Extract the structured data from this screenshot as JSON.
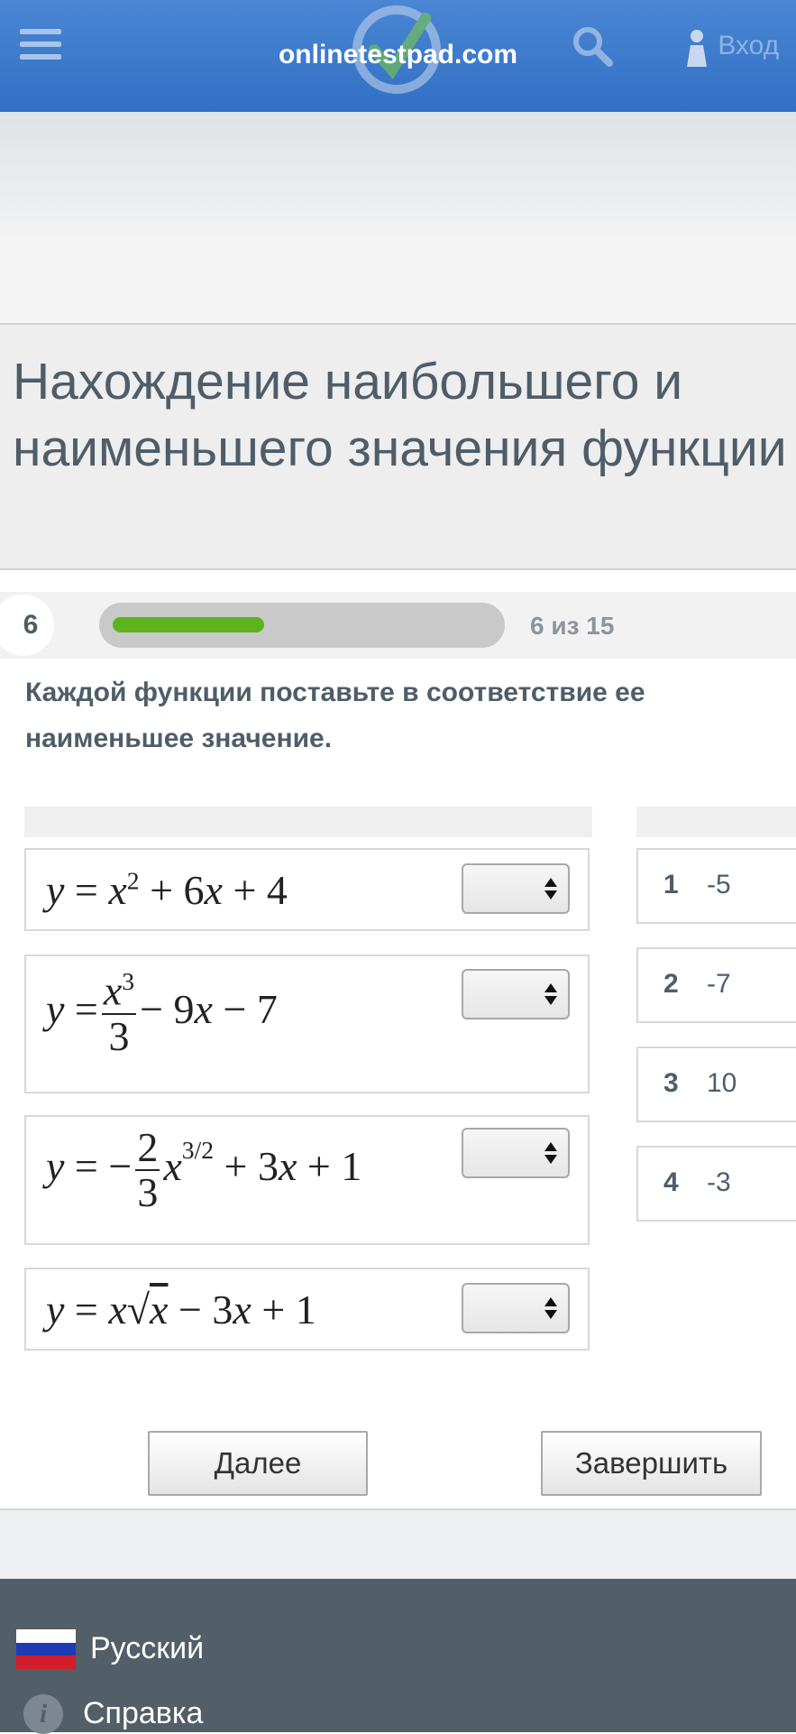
{
  "header": {
    "site_name": "onlinetestpad.com",
    "login_label": "Вход",
    "icons": [
      "hamburger-menu-icon",
      "logo-icon",
      "search-icon",
      "user-icon"
    ]
  },
  "test": {
    "title": "Нахождение наибольшего и наименьшего значения функции"
  },
  "progress": {
    "current_number": "6",
    "text": "6 из 15",
    "fraction": 0.4,
    "bar_color": "#5cb31d"
  },
  "question": {
    "text": "Каждой функции поставьте в соответствие ее наименьшее значение."
  },
  "functions": [
    {
      "formula": "y = x² + 6x + 4",
      "selected": ""
    },
    {
      "formula": "y = x³/3 − 9x − 7",
      "selected": ""
    },
    {
      "formula": "y = −(2/3)x^(3/2) + 3x + 1",
      "selected": ""
    },
    {
      "formula": "y = x√x − 3x + 1",
      "selected": ""
    }
  ],
  "answers": [
    {
      "num": "1",
      "value": "-5"
    },
    {
      "num": "2",
      "value": "-7"
    },
    {
      "num": "3",
      "value": "10"
    },
    {
      "num": "4",
      "value": "-3"
    }
  ],
  "buttons": {
    "next": "Далее",
    "finish": "Завершить"
  },
  "footer": {
    "language": "Русский",
    "help": "Справка"
  },
  "colors": {
    "header_blue": "#3a78c9",
    "footer_gray": "#525e68",
    "text_slate": "#4f5d69"
  }
}
